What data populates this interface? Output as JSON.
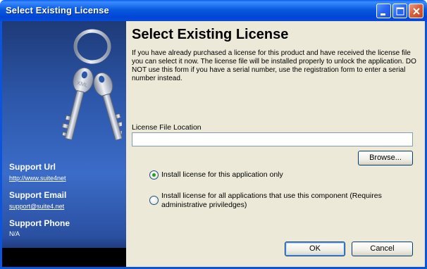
{
  "window": {
    "title": "Select Existing License"
  },
  "sidebar": {
    "support_url_label": "Support Url",
    "support_url_value": "http://www.suite4net",
    "support_email_label": "Support Email",
    "support_email_value": "support@suite4.net",
    "support_phone_label": "Support Phone",
    "support_phone_value": "N/A",
    "key_engraving": "XML"
  },
  "main": {
    "heading": "Select Existing License",
    "description": "If you have already purchased a license for this product and have received the license file you can select it now. The license file will be installed properly to unlock the application. DO NOT use this form if you have a serial number, use the registration form to enter a serial number instead.",
    "file_label": "License File Location",
    "file_value": "",
    "browse_label": "Browse...",
    "radio_options": [
      {
        "label": "Install license for this application only",
        "selected": true
      },
      {
        "label": "Install license for all applications that use this component (Requires administrative priviledges)",
        "selected": false
      }
    ],
    "ok_label": "OK",
    "cancel_label": "Cancel"
  },
  "colors": {
    "titlebar": "#0a54e0",
    "dialog_bg": "#ece9d8",
    "sidebar_blue": "#2c56a8",
    "radio_dot": "#21a121"
  }
}
